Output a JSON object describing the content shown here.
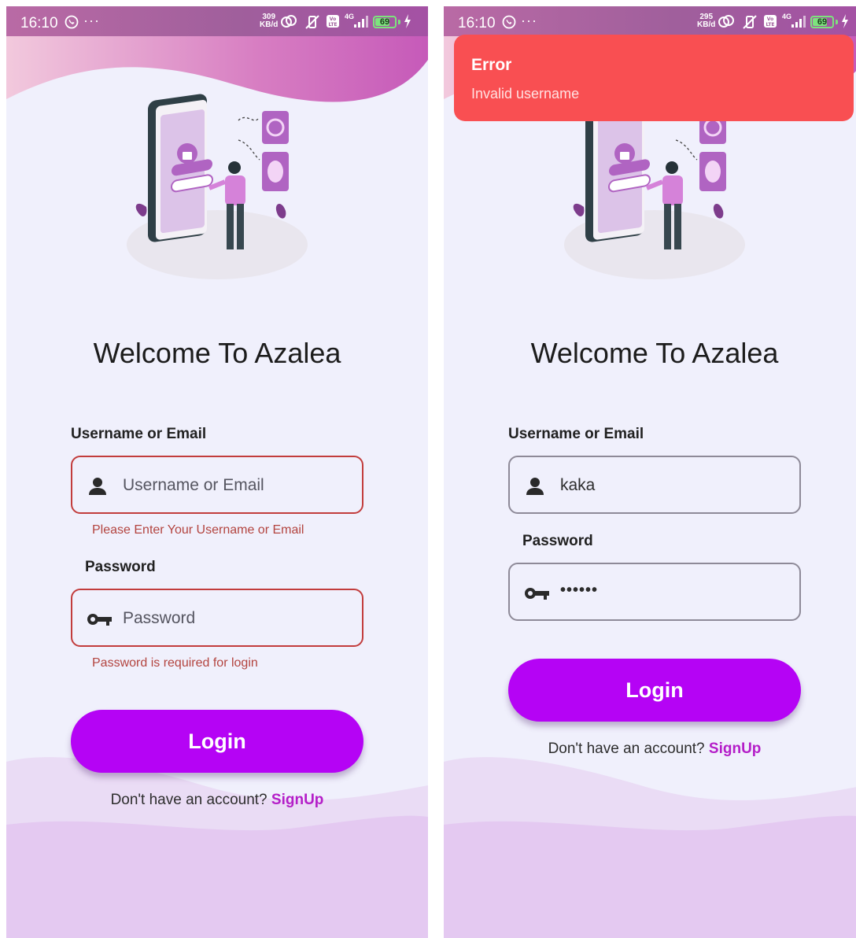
{
  "colors": {
    "accent": "#b503f5",
    "error": "#c23c3c",
    "toast_bg": "#f94f52",
    "background": "#f0f0fc",
    "link": "#b41ec8"
  },
  "icons": {
    "username": "person-icon",
    "password": "key-icon",
    "whatsapp": "whatsapp-icon",
    "battery": "battery-icon"
  },
  "screens": [
    {
      "statusbar": {
        "time": "16:10",
        "more": "···",
        "speed_value": "309",
        "speed_unit": "KB/d",
        "net": "4G",
        "battery": "69"
      },
      "welcome": "Welcome To Azalea",
      "username_label": "Username or Email",
      "username_value": "",
      "username_placeholder": "Username or Email",
      "username_error": "Please Enter Your Username or Email",
      "password_label": "Password",
      "password_value": "",
      "password_placeholder": "Password",
      "password_error": "Password is required for login",
      "login": "Login",
      "signup_prompt": "Don't have an account?",
      "signup_link": "SignUp"
    },
    {
      "statusbar": {
        "time": "16:10",
        "more": "···",
        "speed_value": "295",
        "speed_unit": "KB/d",
        "net": "4G",
        "battery": "69"
      },
      "toast": {
        "title": "Error",
        "message": "Invalid username"
      },
      "welcome": "Welcome To Azalea",
      "username_label": "Username or Email",
      "username_value": "kaka",
      "password_label": "Password",
      "password_value": "••••••",
      "login": "Login",
      "signup_prompt": "Don't have an account?",
      "signup_link": "SignUp"
    }
  ]
}
